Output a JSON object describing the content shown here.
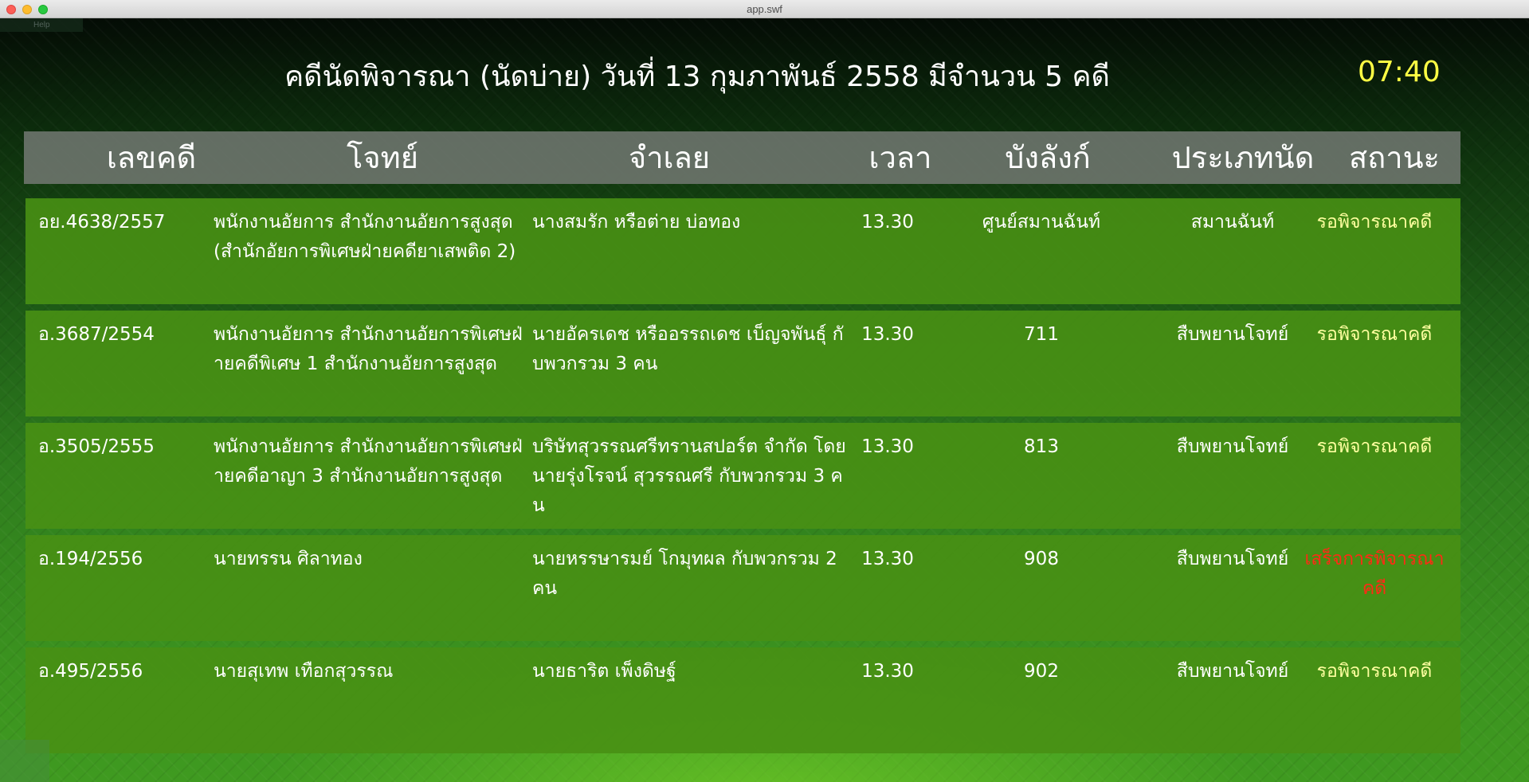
{
  "window": {
    "title": "app.swf"
  },
  "menu": {
    "help_label": "Help"
  },
  "header": {
    "title": "คดีนัดพิจารณา (นัดบ่าย) วันที่ 13 กุมภาพันธ์ 2558 มีจำนวน 5 คดี",
    "clock": "07:40"
  },
  "colors": {
    "clock": "#ffff44",
    "status_pending": "#ffffa0",
    "status_done": "#ff2a14",
    "row_background": "#489014"
  },
  "table": {
    "columns": [
      "เลขคดี",
      "โจทย์",
      "จำเลย",
      "เวลา",
      "บังลังก์",
      "ประเภทนัด",
      "สถานะ"
    ],
    "rows": [
      {
        "case_number": "อย.4638/2557",
        "plaintiff": "พนักงานอัยการ สำนักงานอัยการสูงสุด (สำนักอัยการพิเศษฝ่ายคดียาเสพติด 2)",
        "defendant": "นางสมรัก หรือต่าย บ่อทอง",
        "time": "13.30",
        "courtroom": "ศูนย์สมานฉันท์",
        "appointment_type": "สมานฉันท์",
        "status": "รอพิจารณาคดี"
      },
      {
        "case_number": "อ.3687/2554",
        "plaintiff": "พนักงานอัยการ สำนักงานอัยการพิเศษฝ่ายคดีพิเศษ 1 สำนักงานอัยการสูงสุด",
        "defendant": " นายอัครเดช หรืออรรถเดช เบ็ญจพันธุ์ กับพวกรวม 3 คน",
        "time": "13.30",
        "courtroom": "711",
        "appointment_type": "สืบพยานโจทย์",
        "status": "รอพิจารณาคดี"
      },
      {
        "case_number": "อ.3505/2555",
        "plaintiff": "พนักงานอัยการ สำนักงานอัยการพิเศษฝ่ายคดีอาญา 3 สำนักงานอัยการสูงสุด",
        "defendant": " บริษัทสุวรรณศรีทรานสปอร์ต จำกัด โดย นายรุ่งโรจน์ สุวรรณศรี กับพวกรวม 3 คน",
        "time": "13.30",
        "courtroom": "813",
        "appointment_type": "สืบพยานโจทย์",
        "status": "รอพิจารณาคดี"
      },
      {
        "case_number": "อ.194/2556",
        "plaintiff": "นายทรรน ศิลาทอง",
        "defendant": " นายหรรษารมย์ โกมุทผล กับพวกรวม 2 คน",
        "time": "13.30",
        "courtroom": "908",
        "appointment_type": "สืบพยานโจทย์",
        "status": "เสร็จการพิจารณาคดี"
      },
      {
        "case_number": "อ.495/2556",
        "plaintiff": "นายสุเทพ เทือกสุวรรณ",
        "defendant": "นายธาริต เพ็งดิษฐ์",
        "time": "13.30",
        "courtroom": "902",
        "appointment_type": "สืบพยานโจทย์",
        "status": "รอพิจารณาคดี"
      }
    ]
  }
}
